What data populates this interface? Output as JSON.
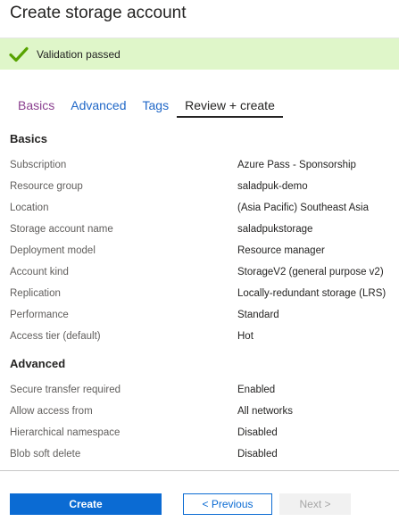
{
  "header": {
    "title": "Create storage account"
  },
  "validation": {
    "message": "Validation passed",
    "status_color": "#dff6c9",
    "icon": "checkmark-icon"
  },
  "tabs": [
    {
      "label": "Basics"
    },
    {
      "label": "Advanced"
    },
    {
      "label": "Tags"
    },
    {
      "label": "Review + create"
    }
  ],
  "basics": {
    "heading": "Basics",
    "rows": [
      {
        "label": "Subscription",
        "value": "Azure Pass - Sponsorship"
      },
      {
        "label": "Resource group",
        "value": "saladpuk-demo"
      },
      {
        "label": "Location",
        "value": "(Asia Pacific) Southeast Asia"
      },
      {
        "label": "Storage account name",
        "value": "saladpukstorage"
      },
      {
        "label": "Deployment model",
        "value": "Resource manager"
      },
      {
        "label": "Account kind",
        "value": "StorageV2 (general purpose v2)"
      },
      {
        "label": "Replication",
        "value": "Locally-redundant storage (LRS)"
      },
      {
        "label": "Performance",
        "value": "Standard"
      },
      {
        "label": "Access tier (default)",
        "value": "Hot"
      }
    ]
  },
  "advanced": {
    "heading": "Advanced",
    "rows": [
      {
        "label": "Secure transfer required",
        "value": "Enabled"
      },
      {
        "label": "Allow access from",
        "value": "All networks"
      },
      {
        "label": "Hierarchical namespace",
        "value": "Disabled"
      },
      {
        "label": "Blob soft delete",
        "value": "Disabled"
      }
    ]
  },
  "footer": {
    "create_label": "Create",
    "previous_label": "< Previous",
    "next_label": "Next >"
  }
}
